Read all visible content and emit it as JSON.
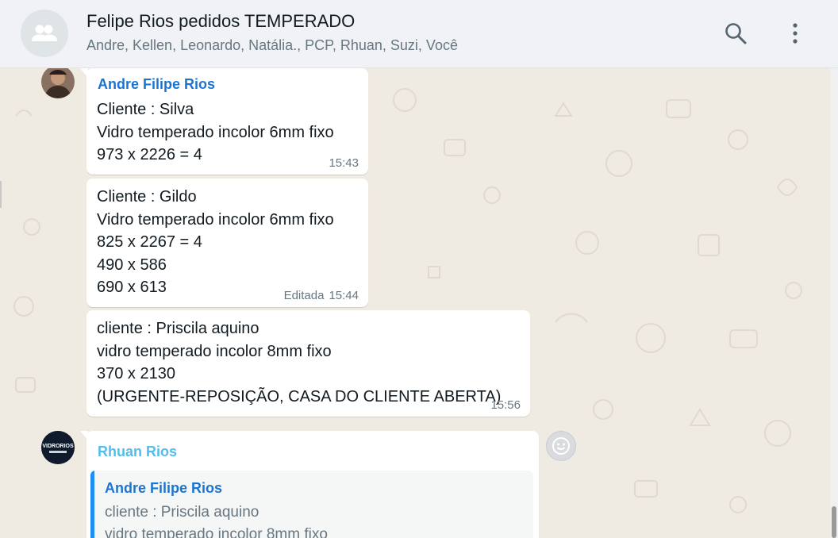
{
  "header": {
    "title": "Felipe Rios pedidos TEMPERADO",
    "members": "Andre, Kellen, Leonardo, Natália., PCP, Rhuan, Suzi, Você",
    "group_avatar_icon": "group-icon",
    "search_icon": "search-icon",
    "menu_icon": "more-vertical-icon"
  },
  "messages": [
    {
      "sender": "Andre Filipe Rios",
      "lines": [
        "Cliente : Silva",
        "Vidro temperado incolor 6mm fixo",
        "973 x 2226 = 4"
      ],
      "time": "15:43"
    },
    {
      "lines": [
        "Cliente : Gildo",
        "Vidro temperado incolor 6mm fixo",
        "825 x 2267 = 4",
        "490 x 586",
        "690 x 613"
      ],
      "edited": "Editada",
      "time": "15:44"
    },
    {
      "lines": [
        "cliente : Priscila aquino",
        "vidro temperado incolor 8mm fixo",
        "370 x 2130",
        "(URGENTE-REPOSIÇÃO, CASA DO CLIENTE ABERTA)"
      ],
      "time": "15:56"
    },
    {
      "sender": "Rhuan Rios",
      "avatar_text": "VIDRORIOS",
      "quote": {
        "sender": "Andre Filipe Rios",
        "lines": [
          "cliente : Priscila aquino",
          "vidro temperado incolor 8mm fixo"
        ]
      }
    }
  ],
  "colors": {
    "andre_name": "#1b75d0",
    "rhuan_name": "#53bdeb",
    "chat_background": "#efeae2",
    "header_background": "#f0f2f5"
  },
  "emoji_icon": "emoji-icon"
}
